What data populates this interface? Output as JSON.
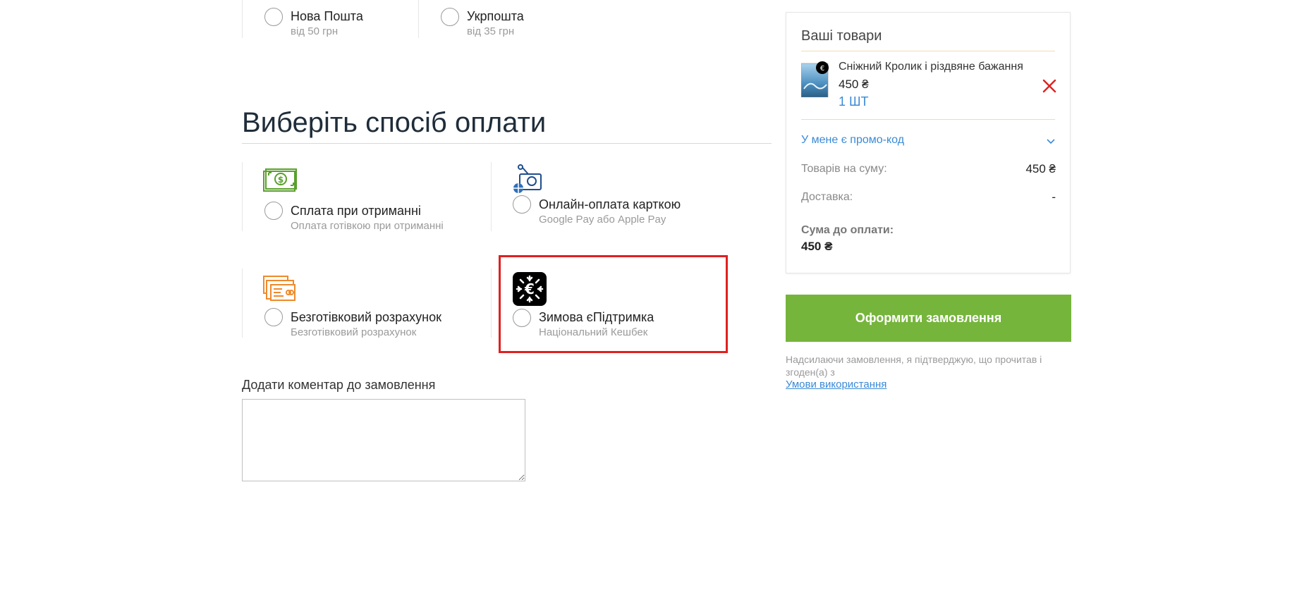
{
  "delivery": {
    "options": [
      {
        "title": "Нова Пошта",
        "sub": "від 50 грн"
      },
      {
        "title": "Укрпошта",
        "sub": "від 35 грн"
      }
    ]
  },
  "payment": {
    "heading": "Виберіть спосіб оплати",
    "options": [
      {
        "title": "Сплата при отриманні",
        "sub": "Оплата готівкою при отриманні",
        "icon": "cash-icon"
      },
      {
        "title": "Онлайн-оплата карткою",
        "sub": "Google Pay або Apple Pay",
        "icon": "online-wallet-icon"
      },
      {
        "title": "Безготівковий розрахунок",
        "sub": "Безготівковий розрахунок",
        "icon": "invoice-card-icon"
      },
      {
        "title": "Зимова єПідтримка",
        "sub": "Національний Кешбек",
        "icon": "snowflake-euro-icon"
      }
    ]
  },
  "comment": {
    "label": "Додати коментар до замовлення",
    "value": ""
  },
  "summary": {
    "title": "Ваші товари",
    "product": {
      "name": "Сніжний Кролик і різдвяне бажання",
      "price": "450 ₴",
      "qty": "1 ШТ"
    },
    "promo_label": "У мене є промо-код",
    "items_total_label": "Товарів на суму:",
    "items_total_value": "450 ₴",
    "delivery_label": "Доставка:",
    "delivery_value": "-",
    "grand_total_label": "Сума до оплати:",
    "grand_total_value": "450 ₴"
  },
  "submit_label": "Оформити замовлення",
  "consent_text": "Надсилаючи замовлення, я підтверджую, що прочитав і згоден(а) з",
  "terms_link": "Умови використання",
  "colors": {
    "accent_green": "#76b53c",
    "link_blue": "#3a8ad6",
    "highlight_red": "#e02020",
    "remove_red": "#e02020",
    "heading_dark": "#1f2d3a"
  }
}
